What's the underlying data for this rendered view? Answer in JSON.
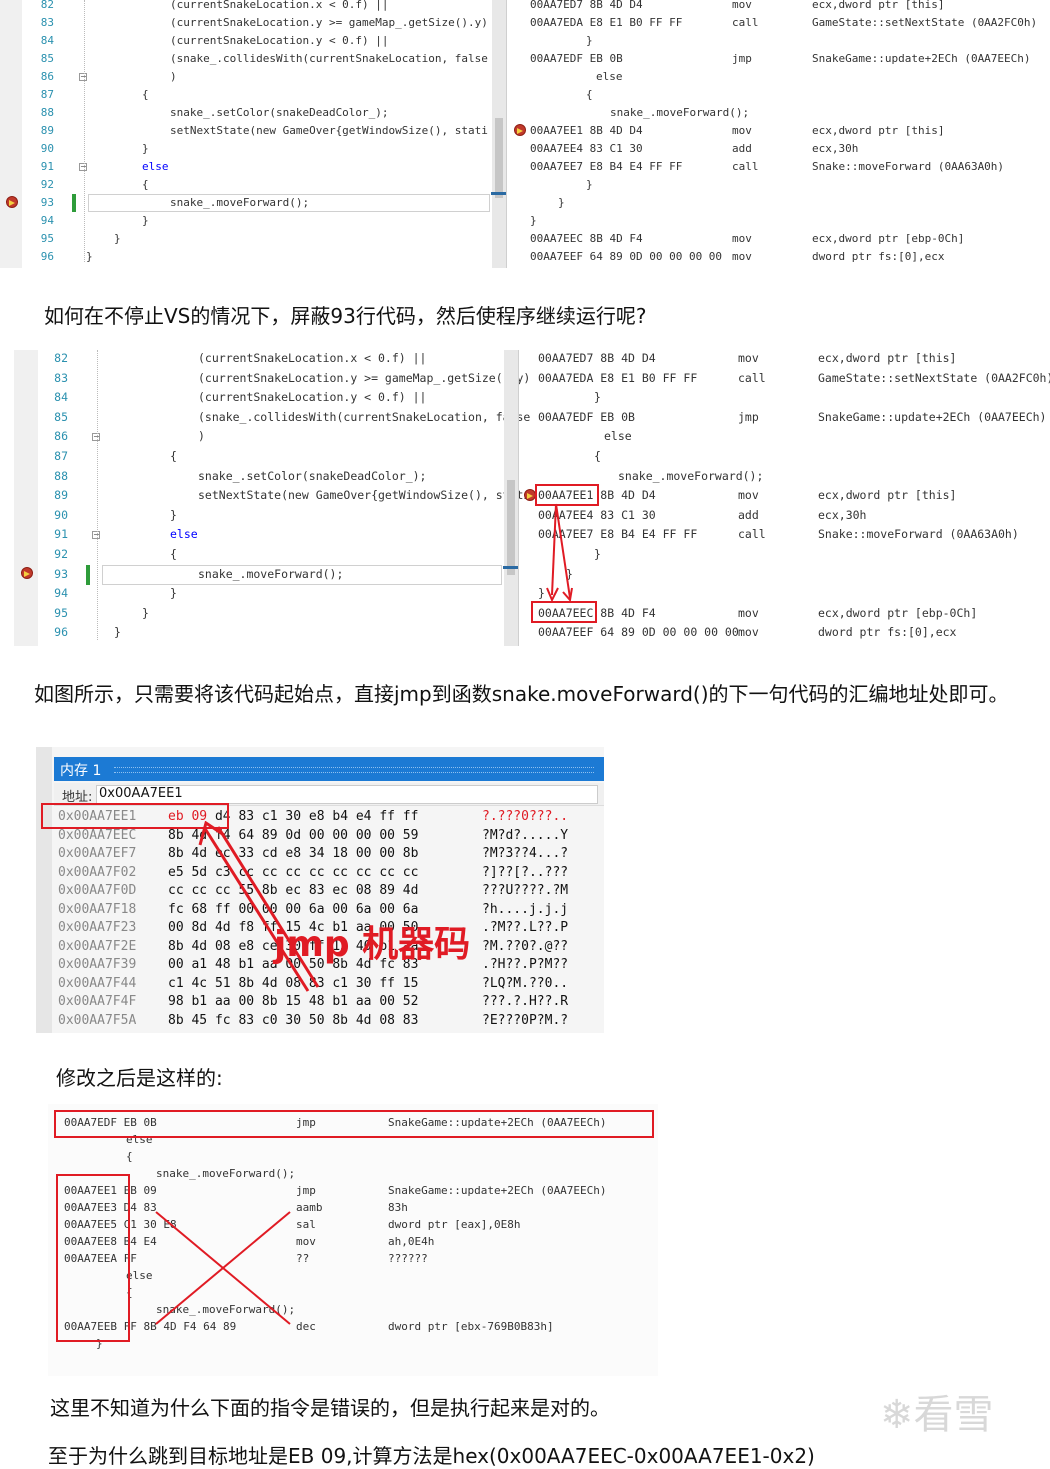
{
  "shot1": {
    "line_numbers": [
      "82",
      "83",
      "84",
      "85",
      "86",
      "87",
      "88",
      "89",
      "90",
      "91",
      "92",
      "93",
      "94",
      "95",
      "96"
    ],
    "code_lines": [
      "(currentSnakeLocation.x < 0.f) ||",
      "(currentSnakeLocation.y >= gameMap_.getSize().y)",
      "(currentSnakeLocation.y < 0.f) ||",
      "(snake_.collidesWith(currentSnakeLocation, false",
      ")",
      "{",
      "snake_.setColor(snakeDeadColor_);",
      "setNextState(new GameOver{getWindowSize(), stati",
      "}",
      "else",
      "{",
      "snake_.moveForward();",
      "}",
      "}",
      "}"
    ],
    "asm_lines": [
      {
        "addr": "00AA7ED7 8B 4D D4",
        "op": "mov",
        "arg": "ecx,dword ptr [this]"
      },
      {
        "addr": "00AA7EDA E8 E1 B0 FF FF",
        "op": "call",
        "arg": "GameState::setNextState (0AA2FC0h)"
      },
      {
        "addr": "}",
        "op": "",
        "arg": ""
      },
      {
        "addr": "00AA7EDF EB 0B",
        "op": "jmp",
        "arg": "SnakeGame::update+2ECh (0AA7EECh)"
      },
      {
        "addr": "else",
        "op": "",
        "arg": ""
      },
      {
        "addr": "{",
        "op": "",
        "arg": ""
      },
      {
        "addr": "snake_.moveForward();",
        "op": "",
        "arg": ""
      },
      {
        "addr": "00AA7EE1 8B 4D D4",
        "op": "mov",
        "arg": "ecx,dword ptr [this]"
      },
      {
        "addr": "00AA7EE4 83 C1 30",
        "op": "add",
        "arg": "ecx,30h"
      },
      {
        "addr": "00AA7EE7 E8 B4 E4 FF FF",
        "op": "call",
        "arg": "Snake::moveForward (0AA63A0h)"
      },
      {
        "addr": "}",
        "op": "",
        "arg": ""
      },
      {
        "addr": "}",
        "op": "",
        "arg": ""
      },
      {
        "addr": "}",
        "op": "",
        "arg": ""
      },
      {
        "addr": "00AA7EEC 8B 4D F4",
        "op": "mov",
        "arg": "ecx,dword ptr [ebp-0Ch]"
      },
      {
        "addr": "00AA7EEF 64 89 0D 00 00 00 00",
        "op": "mov",
        "arg": "dword ptr fs:[0],ecx"
      }
    ]
  },
  "text1": "如何在不停止VS的情况下，屏蔽93行代码，然后使程序继续运行呢?",
  "text2": "如图所示，只需要将该代码起始点，直接jmp到函数snake.moveForward()的下一句代码的汇编地址处即可。",
  "memory": {
    "title": "内存 1",
    "address_label": "地址:",
    "address_value": "0x00AA7EE1",
    "annotation": "jmp 机器码",
    "rows": [
      {
        "addr": "0x00AA7EE1",
        "bytes": "eb 09 d4 83 c1 30 e8 b4 e4 ff ff",
        "ascii": "?.???0???.."
      },
      {
        "addr": "0x00AA7EEC",
        "bytes": "8b 4d f4 64 89 0d 00 00 00 00 59",
        "ascii": "?M?d?.....Y"
      },
      {
        "addr": "0x00AA7EF7",
        "bytes": "8b 4d ec 33 cd e8 34 18 00 00 8b",
        "ascii": "?M?3??4...?"
      },
      {
        "addr": "0x00AA7F02",
        "bytes": "e5 5d c3 cc cc cc cc cc cc cc cc",
        "ascii": "?]??[?..???"
      },
      {
        "addr": "0x00AA7F0D",
        "bytes": "cc cc cc 55 8b ec 83 ec 08 89 4d",
        "ascii": "???U????.?M"
      },
      {
        "addr": "0x00AA7F18",
        "bytes": "fc 68 ff 00 00 00 6a 00 6a 00 6a",
        "ascii": "?h....j.j.j"
      },
      {
        "addr": "0x00AA7F23",
        "bytes": "00 8d 4d f8 ff 15 4c b1 aa 00 50",
        "ascii": ".?M??.L??.P"
      },
      {
        "addr": "0x00AA7F2E",
        "bytes": "8b 4d 08 e8 ce 30 ff 15 40 b1 aa",
        "ascii": "?M.??0?.@??"
      },
      {
        "addr": "0x00AA7F39",
        "bytes": "00 a1 48 b1 aa 00 50 8b 4d fc 83",
        "ascii": ".?H??.P?M??"
      },
      {
        "addr": "0x00AA7F44",
        "bytes": "c1 4c 51 8b 4d 08 83 c1 30 ff 15",
        "ascii": "?LQ?M.??0.."
      },
      {
        "addr": "0x00AA7F4F",
        "bytes": "98 b1 aa 00 8b 15 48 b1 aa 00 52",
        "ascii": "???.?.H??.R"
      },
      {
        "addr": "0x00AA7F5A",
        "bytes": "8b 45 fc 83 c0 30 50 8b 4d 08 83",
        "ascii": "?E???0P?M.?"
      }
    ]
  },
  "text3": "修改之后是这样的:",
  "shot3": {
    "lines": [
      {
        "addr": "00AA7EDF EB 0B",
        "op": "jmp",
        "arg": "SnakeGame::update+2ECh (0AA7EECh)"
      },
      {
        "addr": "else",
        "op": "",
        "arg": ""
      },
      {
        "addr": "{",
        "op": "",
        "arg": ""
      },
      {
        "addr": "snake_.moveForward();",
        "op": "",
        "arg": ""
      },
      {
        "addr": "00AA7EE1 EB 09",
        "op": "jmp",
        "arg": "SnakeGame::update+2ECh (0AA7EECh)"
      },
      {
        "addr": "00AA7EE3 D4 83",
        "op": "aamb",
        "arg": "83h"
      },
      {
        "addr": "00AA7EE5 C1 30 E8",
        "op": "sal",
        "arg": "dword ptr [eax],0E8h"
      },
      {
        "addr": "00AA7EE8 B4 E4",
        "op": "mov",
        "arg": "ah,0E4h"
      },
      {
        "addr": "00AA7EEA FF",
        "op": "??",
        "arg": "??????"
      },
      {
        "addr": "else",
        "op": "",
        "arg": ""
      },
      {
        "addr": "{",
        "op": "",
        "arg": ""
      },
      {
        "addr": "snake_.moveForward();",
        "op": "",
        "arg": ""
      },
      {
        "addr": "00AA7EEB FF 8B 4D F4 64 89",
        "op": "dec",
        "arg": "dword ptr [ebx-769B0B83h]"
      },
      {
        "addr": "}",
        "op": "",
        "arg": ""
      }
    ]
  },
  "text4": "这里不知道为什么下面的指令是错误的，但是执行起来是对的。",
  "text5": "至于为什么跳到目标地址是EB 09,计算方法是hex(0x00AA7EEC-0x00AA7EE1-0x2)",
  "watermark": "看雪"
}
